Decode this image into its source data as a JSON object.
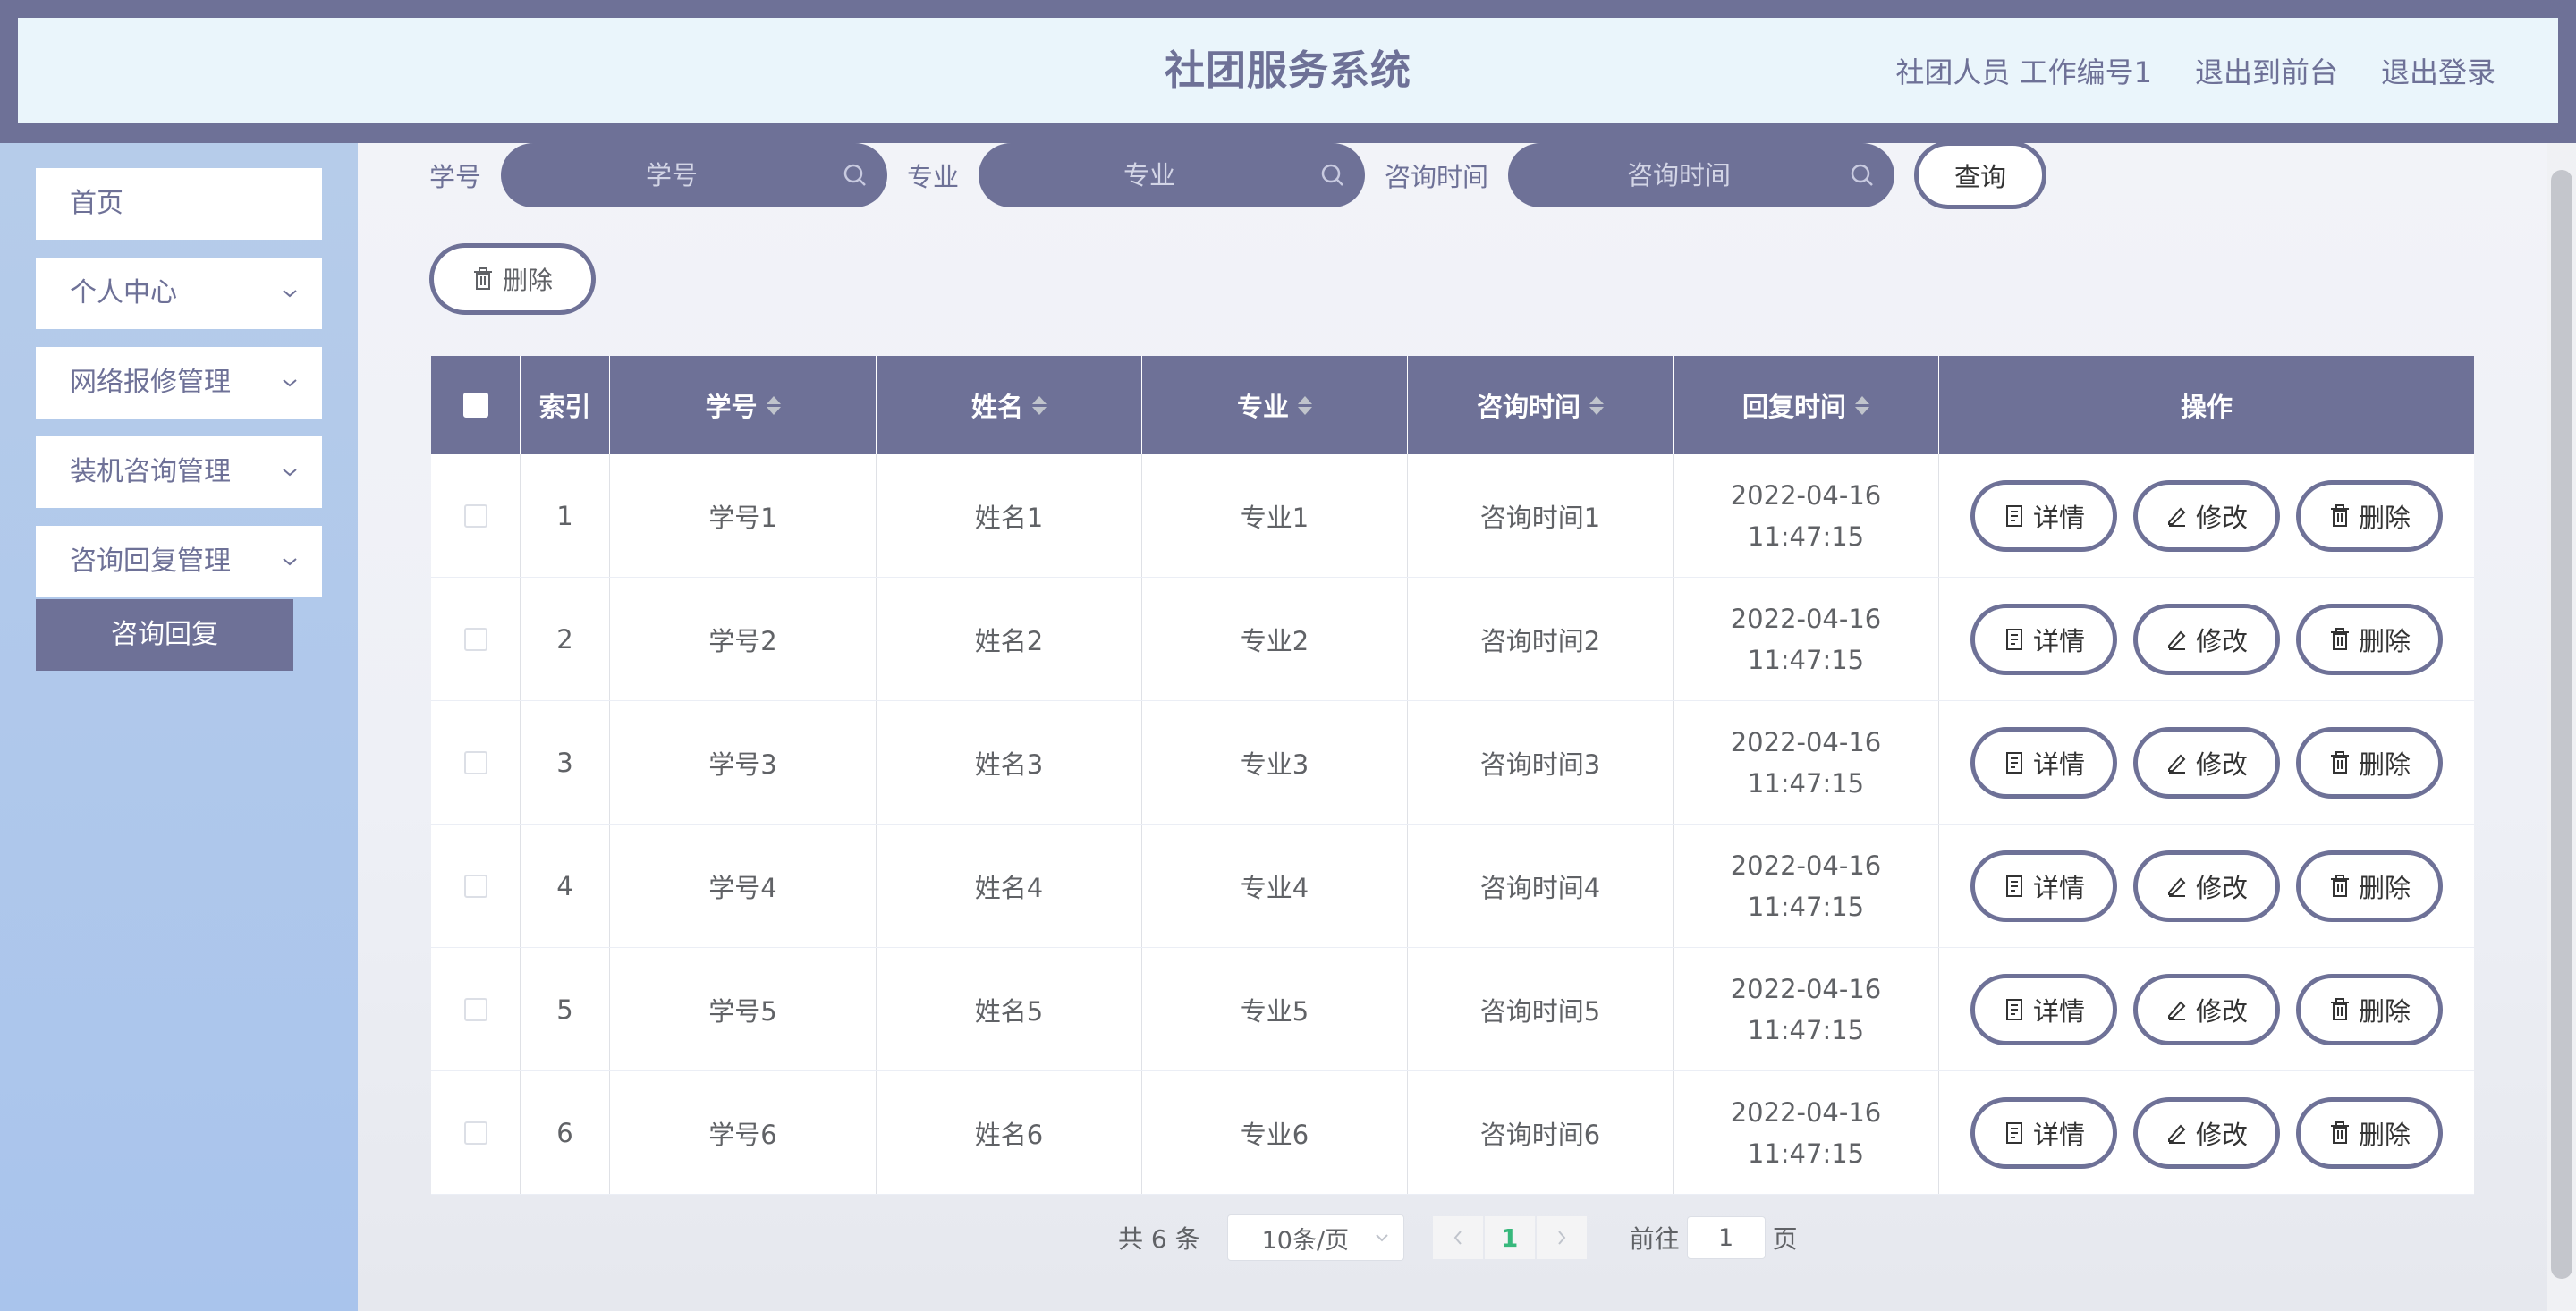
{
  "header": {
    "title": "社团服务系统",
    "user": "社团人员 工作编号1",
    "to_front": "退出到前台",
    "logout": "退出登录"
  },
  "sidebar": {
    "items": [
      {
        "label": "首页",
        "expandable": false
      },
      {
        "label": "个人中心",
        "expandable": true
      },
      {
        "label": "网络报修管理",
        "expandable": true
      },
      {
        "label": "装机咨询管理",
        "expandable": true
      },
      {
        "label": "咨询回复管理",
        "expandable": true
      }
    ],
    "active_sub": "咨询回复"
  },
  "search": {
    "fields": [
      {
        "label": "学号",
        "placeholder": "学号"
      },
      {
        "label": "专业",
        "placeholder": "专业"
      },
      {
        "label": "咨询时间",
        "placeholder": "咨询时间"
      }
    ],
    "query_label": "查询"
  },
  "toolbar": {
    "delete_label": "删除"
  },
  "table": {
    "columns": [
      "索引",
      "学号",
      "姓名",
      "专业",
      "咨询时间",
      "回复时间",
      "操作"
    ],
    "rows": [
      {
        "index": "1",
        "student_no": "学号1",
        "name": "姓名1",
        "major": "专业1",
        "consult_time": "咨询时间1",
        "reply_time": "2022-04-16 11:47:15"
      },
      {
        "index": "2",
        "student_no": "学号2",
        "name": "姓名2",
        "major": "专业2",
        "consult_time": "咨询时间2",
        "reply_time": "2022-04-16 11:47:15"
      },
      {
        "index": "3",
        "student_no": "学号3",
        "name": "姓名3",
        "major": "专业3",
        "consult_time": "咨询时间3",
        "reply_time": "2022-04-16 11:47:15"
      },
      {
        "index": "4",
        "student_no": "学号4",
        "name": "姓名4",
        "major": "专业4",
        "consult_time": "咨询时间4",
        "reply_time": "2022-04-16 11:47:15"
      },
      {
        "index": "5",
        "student_no": "学号5",
        "name": "姓名5",
        "major": "专业5",
        "consult_time": "咨询时间5",
        "reply_time": "2022-04-16 11:47:15"
      },
      {
        "index": "6",
        "student_no": "学号6",
        "name": "姓名6",
        "major": "专业6",
        "consult_time": "咨询时间6",
        "reply_time": "2022-04-16 11:47:15"
      }
    ],
    "actions": {
      "detail": "详情",
      "edit": "修改",
      "delete": "删除"
    }
  },
  "pagination": {
    "total": "共 6 条",
    "page_size": "10条/页",
    "current_page": "1",
    "goto_prefix": "前往",
    "goto_value": "1",
    "goto_suffix": "页"
  },
  "colors": {
    "accent": "#6e7197",
    "header_bg": "#eaf5fb",
    "sidebar_bg": "#b6ccea",
    "pager_active": "#37b87c"
  }
}
